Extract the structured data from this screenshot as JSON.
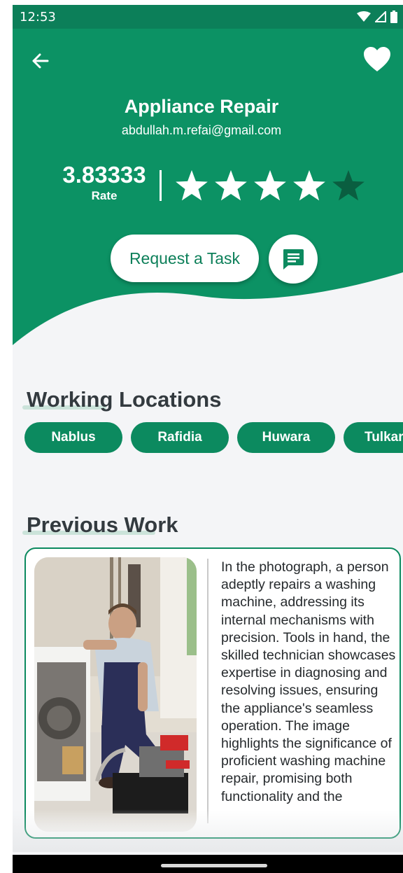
{
  "status_bar": {
    "time": "12:53"
  },
  "header": {
    "title": "Appliance Repair",
    "email": "abdullah.m.refai@gmail.com",
    "rating": {
      "value": "3.83333",
      "label": "Rate",
      "stars_total": 5,
      "stars_filled": 4
    },
    "request_button_label": "Request a Task",
    "colors": {
      "brand": "#0c7f59",
      "star_filled": "#ffffff",
      "star_empty": "#0a5e40"
    }
  },
  "locations": {
    "title": "Working Locations",
    "items": [
      "Nablus",
      "Rafidia",
      "Huwara",
      "Tulkar"
    ]
  },
  "previous_work": {
    "title": "Previous Work",
    "description": "In the photograph, a person adeptly repairs a washing machine, addressing its internal mechanisms with precision. Tools in hand, the skilled technician showcases expertise in diagnosing and resolving issues, ensuring the appliance's seamless operation. The image highlights the significance of proficient washing machine repair, promising both functionality and the"
  },
  "icons": {
    "back": "arrow-back-icon",
    "favorite": "heart-icon",
    "message": "chat-icon",
    "wifi": "wifi-icon",
    "signal": "signal-icon",
    "battery": "battery-icon"
  }
}
